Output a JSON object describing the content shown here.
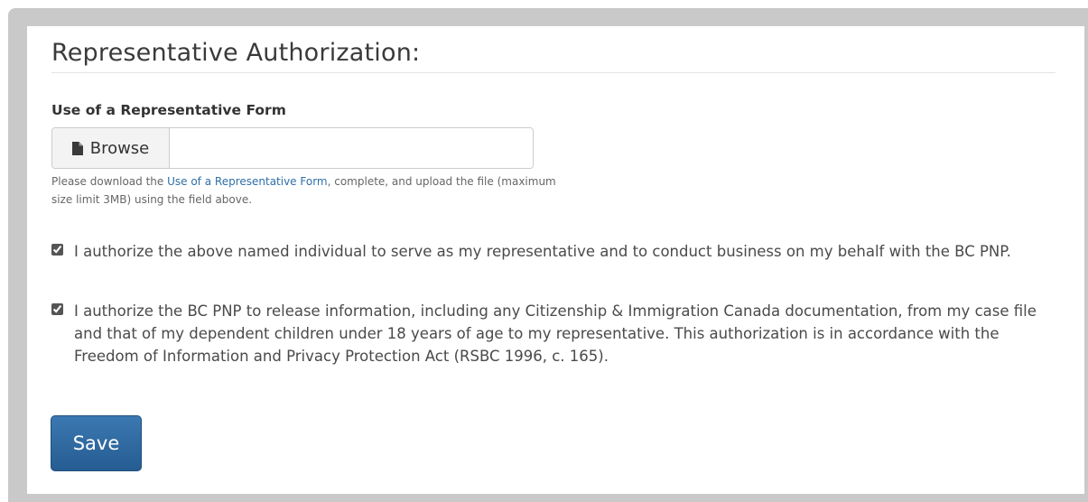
{
  "section": {
    "title": "Representative Authorization:"
  },
  "upload": {
    "label": "Use of a Representative Form",
    "browse_label": "Browse",
    "file_value": "",
    "help_prefix": "Please download the ",
    "help_link": "Use of a Representative Form",
    "help_suffix": ", complete, and upload the file (maximum size limit 3MB) using the field above."
  },
  "authorizations": [
    {
      "checked": true,
      "text": "I authorize the above named individual to serve as my representative and to conduct business on my behalf with the BC PNP."
    },
    {
      "checked": true,
      "text": "I authorize the BC PNP to release information, including any Citizenship & Immigration Canada documentation, from my case file and that of my dependent children under 18 years of age to my representative. This authorization is in accordance with the Freedom of Information and Privacy Protection Act (RSBC 1996, c. 165)."
    }
  ],
  "actions": {
    "save_label": "Save"
  },
  "icons": {
    "browse": "file-icon"
  },
  "colors": {
    "primary_button": "#2d6aa3",
    "link": "#2f6fa7"
  }
}
